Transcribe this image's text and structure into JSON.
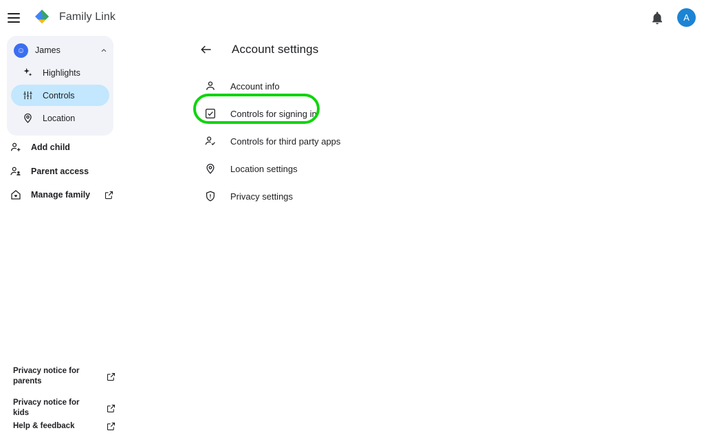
{
  "app": {
    "title": "Family Link",
    "logo_colors": {
      "blue": "#4285F4",
      "green": "#34A853",
      "yellow": "#FBBC04"
    },
    "menu_icon": "hamburger-menu-icon",
    "notifications_icon": "notification-bell-icon",
    "account_avatar_letter": "A",
    "account_avatar_color": "#1b84d4"
  },
  "sidebar": {
    "child": {
      "name": "James",
      "avatar_icon": "child-avatar",
      "avatar_color": "#3b6ef0",
      "collapse_icon": "chevron-up-icon",
      "expanded": true
    },
    "child_nav": [
      {
        "label": "Highlights",
        "icon": "sparkle-icon",
        "selected": false
      },
      {
        "label": "Controls",
        "icon": "tune-sliders-icon",
        "selected": true
      },
      {
        "label": "Location",
        "icon": "location-pin-icon",
        "selected": false
      }
    ],
    "selected_pill_color": "#c2e7ff",
    "panel_color": "#f1f3f8",
    "links": [
      {
        "label": "Add child",
        "icon": "person-add-icon",
        "external": false
      },
      {
        "label": "Parent access",
        "icon": "people-icon",
        "external": false
      },
      {
        "label": "Manage family",
        "icon": "home-heart-icon",
        "external": true
      }
    ],
    "footer_links": [
      {
        "label": "Privacy notice for parents",
        "icon": "open-in-new-icon"
      },
      {
        "label": "Privacy notice for kids",
        "icon": "open-in-new-icon"
      },
      {
        "label": "Help & feedback",
        "icon": "open-in-new-icon"
      }
    ]
  },
  "main": {
    "back_icon": "back-arrow-icon",
    "title": "Account settings",
    "items": [
      {
        "label": "Account info",
        "icon": "person-icon",
        "highlighted": false
      },
      {
        "label": "Controls for signing in",
        "icon": "checkbox-icon",
        "highlighted": true
      },
      {
        "label": "Controls for third party apps",
        "icon": "person-check-icon",
        "highlighted": false
      },
      {
        "label": "Location settings",
        "icon": "location-pin-icon",
        "highlighted": false
      },
      {
        "label": "Privacy settings",
        "icon": "shield-icon",
        "highlighted": false
      }
    ]
  },
  "annotation": {
    "target": "Controls for signing in",
    "color": "#10d40e",
    "shape": "rounded-rectangle-outline"
  }
}
